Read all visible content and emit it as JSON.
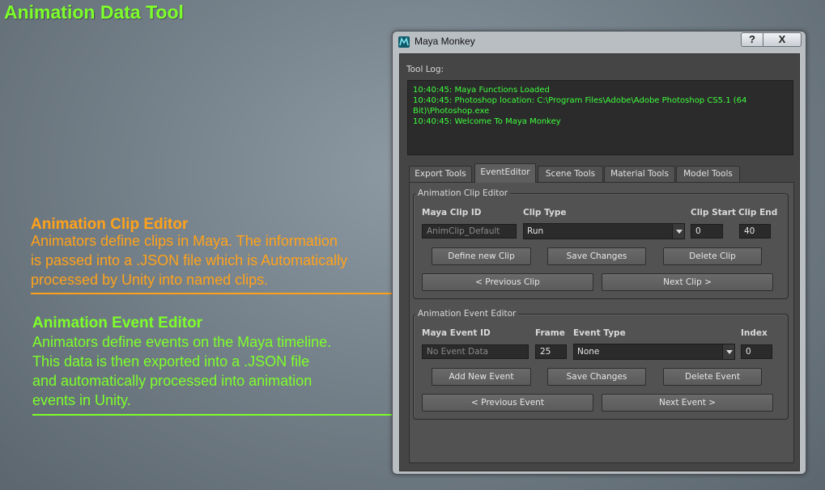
{
  "page": {
    "title": "Animation Data Tool",
    "notes": [
      {
        "title": "Animation Clip Editor",
        "lines": [
          "Animators define clips in Maya. The information",
          "is passed into a .JSON file which is Automatically",
          "processed by Unity into named clips."
        ],
        "color": "#ffa21a"
      },
      {
        "title": "Animation Event Editor",
        "lines": [
          "Animators define events on the Maya timeline.",
          "This data is then exported into a .JSON file",
          "and automatically processed into animation",
          "events in Unity."
        ],
        "color": "#7dff2a"
      }
    ]
  },
  "window": {
    "title": "Maya Monkey",
    "help_label": "?",
    "close_label": "X",
    "app_icon": "maya-icon"
  },
  "tool_log": {
    "label": "Tool Log:",
    "lines": [
      "10:40:45: Maya Functions Loaded",
      "10:40:45: Photoshop location: C:\\Program Files\\Adobe\\Adobe Photoshop CS5.1 (64",
      "Bit)\\Photoshop.exe",
      "10:40:45: Welcome To Maya Monkey"
    ],
    "text_color": "#3dff3d"
  },
  "tabs": [
    {
      "label": "Export Tools",
      "active": false
    },
    {
      "label": "EventEditor",
      "active": true
    },
    {
      "label": "Scene Tools",
      "active": false
    },
    {
      "label": "Material Tools",
      "active": false
    },
    {
      "label": "Model Tools",
      "active": false
    }
  ],
  "clip_editor": {
    "title": "Animation Clip Editor",
    "headers": {
      "clip_id": "Maya Clip ID",
      "clip_type": "Clip Type",
      "clip_start": "Clip Start",
      "clip_end": "Clip End"
    },
    "clip_id_placeholder": "AnimClip_Default",
    "clip_type_value": "Run",
    "clip_start_value": "0",
    "clip_end_value": "40",
    "buttons": {
      "define_new": "Define new Clip",
      "save_changes": "Save Changes",
      "delete": "Delete Clip",
      "previous": "< Previous Clip",
      "next": "Next Clip >"
    }
  },
  "event_editor": {
    "title": "Animation Event Editor",
    "headers": {
      "event_id": "Maya Event ID",
      "frame": "Frame",
      "event_type": "Event Type",
      "index": "Index"
    },
    "event_id_placeholder": "No Event Data",
    "frame_value": "25",
    "event_type_value": "None",
    "index_value": "0",
    "buttons": {
      "add_new": "Add New Event",
      "save_changes": "Save Changes",
      "delete": "Delete Event",
      "previous": "< Previous Event",
      "next": "Next Event >"
    }
  }
}
